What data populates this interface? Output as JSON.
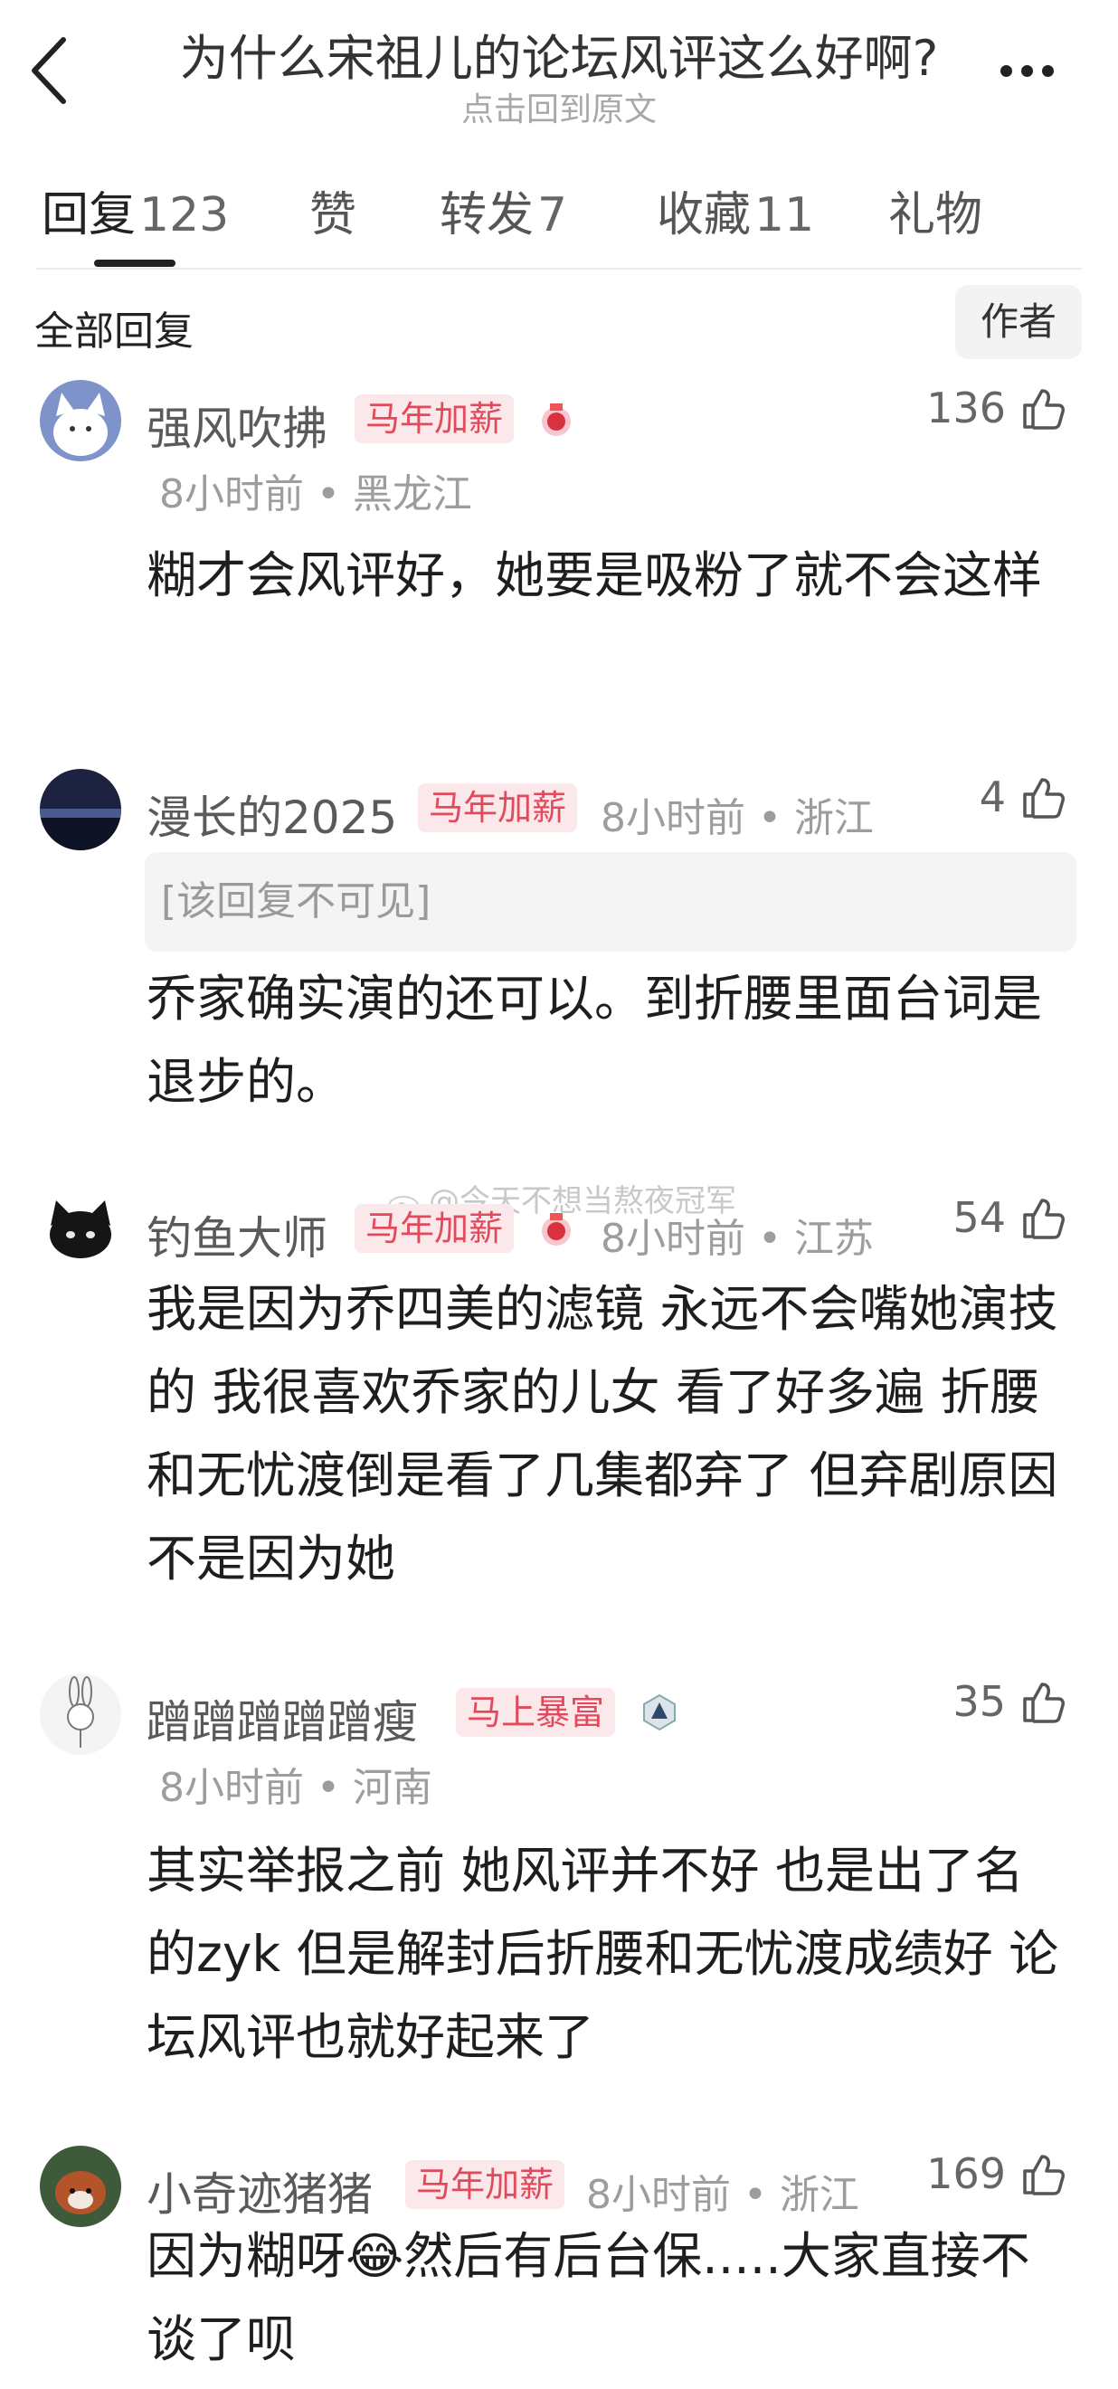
{
  "header": {
    "title": "为什么宋祖儿的论坛风评这么好啊?",
    "subtitle": "点击回到原文"
  },
  "tabs": [
    {
      "label": "回复",
      "count": "123"
    },
    {
      "label": "赞",
      "count": ""
    },
    {
      "label": "转发",
      "count": "7"
    },
    {
      "label": "收藏",
      "count": "11"
    },
    {
      "label": "礼物",
      "count": ""
    }
  ],
  "filter": {
    "label": "全部回复",
    "author_btn": "作者"
  },
  "watermark": "@今天不想当熬夜冠军",
  "comments": [
    {
      "user": "强风吹拂",
      "badge": "马年加薪",
      "time": "8小时前",
      "loc": "黑龙江",
      "likes": "136",
      "text": "糊才会风评好，她要是吸粉了就不会这样",
      "quote": ""
    },
    {
      "user": "漫长的2025",
      "badge": "马年加薪",
      "time": "8小时前",
      "loc": "浙江",
      "likes": "4",
      "text": "乔家确实演的还可以。到折腰里面台词是退步的。",
      "quote": "[该回复不可见]"
    },
    {
      "user": "钓鱼大师",
      "badge": "马年加薪",
      "time": "8小时前",
      "loc": "江苏",
      "likes": "54",
      "text": "我是因为乔四美的滤镜 永远不会嘴她演技的 我很喜欢乔家的儿女 看了好多遍 折腰和无忧渡倒是看了几集都弃了 但弃剧原因不是因为她",
      "quote": ""
    },
    {
      "user": "蹭蹭蹭蹭蹭瘦",
      "badge": "马上暴富",
      "time": "8小时前",
      "loc": "河南",
      "likes": "35",
      "text": "其实举报之前 她风评并不好 也是出了名的zyk 但是解封后折腰和无忧渡成绩好 论坛风评也就好起来了",
      "quote": ""
    },
    {
      "user": "小奇迹猪猪",
      "badge": "马年加薪",
      "time": "8小时前",
      "loc": "浙江",
      "likes": "169",
      "text_a": "因为糊呀",
      "emoji": "😂",
      "text_b": "然后有后台保.....大家直接不谈了呗",
      "quote": ""
    }
  ]
}
